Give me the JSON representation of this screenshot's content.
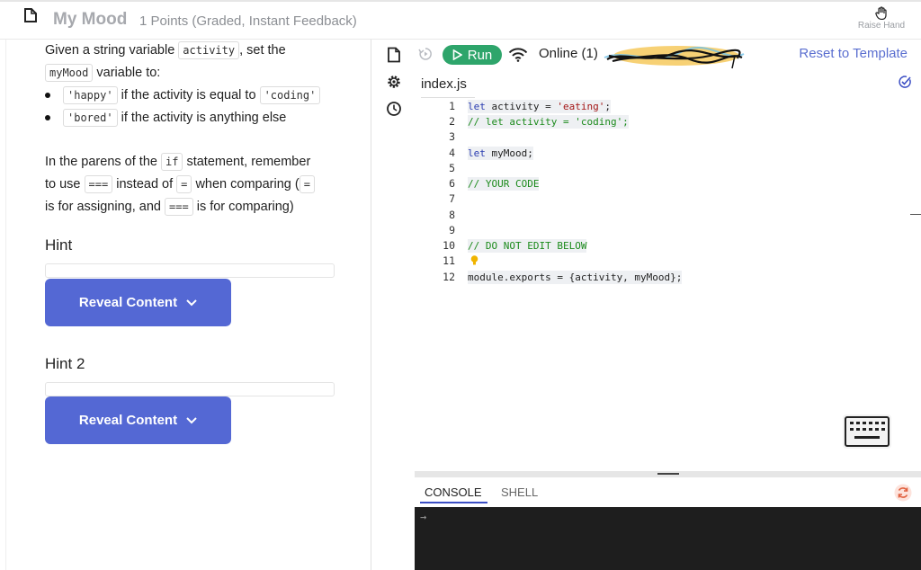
{
  "header": {
    "title": "My Mood",
    "subtitle": "1 Points (Graded, Instant Feedback)",
    "raise_hand_label": "Raise Hand"
  },
  "instructions": {
    "p1_pre": "Given a string variable",
    "p1_code_a": "activity",
    "p1_mid": ", set the",
    "p1_code_b": "myMood",
    "p1_post": "variable to:",
    "bullet1_code": "'happy'",
    "bullet1_mid": "if the activity is equal to",
    "bullet1_code2": "'coding'",
    "bullet2_code": "'bored'",
    "bullet2_text": "if the activity is anything else",
    "p2_a": "In the parens of the",
    "p2_code_if": "if",
    "p2_b": "statement, remember",
    "p2_c": "to use",
    "p2_code_triple": "===",
    "p2_d": "instead of",
    "p2_code_eq": "=",
    "p2_e": "when comparing (",
    "p2_code_eq2": "=",
    "p2_f": "is for assigning, and",
    "p2_code_triple2": "===",
    "p2_g": "is for comparing)"
  },
  "hints": [
    {
      "title": "Hint",
      "button_label": "Reveal Content"
    },
    {
      "title": "Hint 2",
      "button_label": "Reveal Content"
    }
  ],
  "toolbar": {
    "run_label": "Run",
    "online_status": "Online (1)",
    "reset_label": "Reset to Template"
  },
  "editor": {
    "file_tab": "index.js",
    "line_numbers": [
      "1",
      "2",
      "3",
      "4",
      "5",
      "6",
      "7",
      "8",
      "9",
      "10",
      "11",
      "12"
    ],
    "code": {
      "l1_kw": "let",
      "l1_mid": " activity = ",
      "l1_str": "'eating'",
      "l1_end": ";",
      "l2": "// let activity = 'coding';",
      "l4_kw": "let",
      "l4_rest": " myMood;",
      "l6": "// YOUR CODE",
      "l10": "// DO NOT EDIT BELOW",
      "l12": "module.exports = {activity, myMood};"
    }
  },
  "console": {
    "tab_console": "CONSOLE",
    "tab_shell": "SHELL",
    "prompt": "→"
  },
  "colors": {
    "accent": "#5468d4",
    "run": "#2ea56b",
    "link": "#5b6fd0",
    "console_bg": "#1e1e1e"
  },
  "icons": [
    "file-icon",
    "raise-hand-icon",
    "settings-icon",
    "history-icon",
    "restart-icon",
    "play-icon",
    "wifi-icon",
    "check-icon",
    "lightbulb-icon",
    "keyboard-icon",
    "refresh-icon",
    "chevron-down-icon"
  ]
}
